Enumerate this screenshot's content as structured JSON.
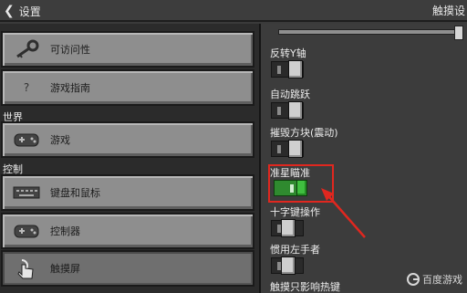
{
  "topbar": {
    "back_icon": "chevron-left-icon",
    "title": "设置",
    "right_title": "触摸设"
  },
  "left": {
    "items_top": [
      {
        "label": "可访问性",
        "icon": "key-icon"
      },
      {
        "label": "游戏指南",
        "icon": "question-icon"
      }
    ],
    "section_world": "世界",
    "item_game": {
      "label": "游戏",
      "icon": "gamepad-icon"
    },
    "section_controls": "控制",
    "items_controls": [
      {
        "label": "键盘和鼠标",
        "icon": "keyboard-icon"
      },
      {
        "label": "控制器",
        "icon": "gamepad-icon"
      },
      {
        "label": "触摸屏",
        "icon": "touch-icon",
        "selected": true
      }
    ]
  },
  "right": {
    "options": [
      {
        "label": "反转Y轴",
        "state": "off"
      },
      {
        "label": "自动跳跃",
        "state": "off"
      },
      {
        "label": "摧毁方块(震动)",
        "state": "off"
      },
      {
        "label": "准星瞄准",
        "state": "on"
      },
      {
        "label": "十字键操作",
        "state": "off"
      },
      {
        "label": "惯用左手者",
        "state": "off"
      },
      {
        "label": "触摸只影响热键",
        "state": "off"
      }
    ]
  },
  "colors": {
    "highlight": "#e0271f",
    "toggle_on": "#3fbf3f"
  },
  "watermark": "百度游戏"
}
